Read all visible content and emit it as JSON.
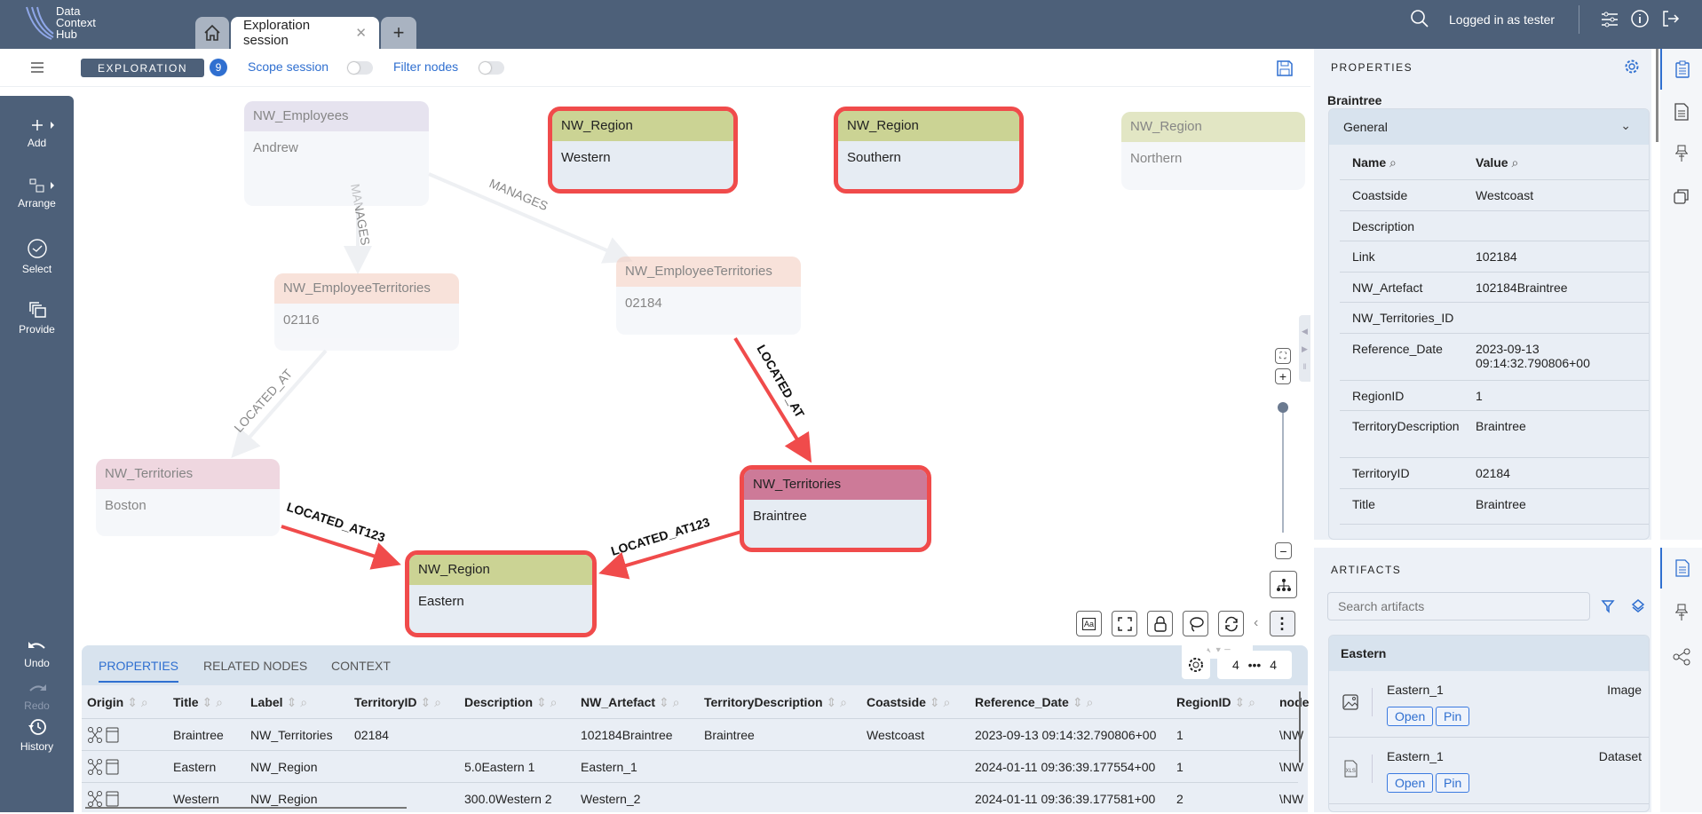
{
  "app": {
    "logo_lines": [
      "Data",
      "Context",
      "Hub"
    ],
    "tabs": [
      {
        "label": "Exploration session"
      }
    ],
    "user_text": "Logged in as tester"
  },
  "toolbar": {
    "mode": "EXPLORATION",
    "count": "9",
    "scope_session": "Scope session",
    "filter_nodes": "Filter nodes",
    "scope_on": false,
    "filter_on": false
  },
  "sidebar": {
    "items": [
      {
        "label": "Add",
        "icon": "plus-icon"
      },
      {
        "label": "Arrange",
        "icon": "arrange-icon"
      },
      {
        "label": "Select",
        "icon": "check-circle-icon"
      },
      {
        "label": "Provide",
        "icon": "copy-icon"
      }
    ],
    "bottom": [
      {
        "label": "Undo",
        "icon": "undo-icon"
      },
      {
        "label": "Redo",
        "icon": "redo-icon",
        "disabled": true
      },
      {
        "label": "History",
        "icon": "history-icon"
      }
    ]
  },
  "graph": {
    "colors": {
      "NW_Employees": "#d3cde3",
      "NW_Region": "#cbd394",
      "NW_EmployeeTerritories": "#f3cbbd",
      "NW_Territories": "#e3b7c7",
      "NW_Territories_selected": "#cd7a98",
      "selection": "#f04b4b"
    },
    "nodes": [
      {
        "label": "NW_Employees",
        "title": "Andrew"
      },
      {
        "label": "NW_Region",
        "title": "Western"
      },
      {
        "label": "NW_Region",
        "title": "Southern"
      },
      {
        "label": "NW_Region",
        "title": "Northern"
      },
      {
        "label": "NW_EmployeeTerritories",
        "title": "02116"
      },
      {
        "label": "NW_EmployeeTerritories",
        "title": "02184"
      },
      {
        "label": "NW_Territories",
        "title": "Boston"
      },
      {
        "label": "NW_Territories",
        "title": "Braintree"
      },
      {
        "label": "NW_Region",
        "title": "Eastern"
      }
    ],
    "edges": [
      {
        "from": "Andrew",
        "to": "02116",
        "label": "MANAGES"
      },
      {
        "from": "Andrew",
        "to": "02184",
        "label": "MANAGES"
      },
      {
        "from": "02116",
        "to": "Boston",
        "label": "LOCATED_AT"
      },
      {
        "from": "02184",
        "to": "Braintree",
        "label": "LOCATED_AT"
      },
      {
        "from": "Boston",
        "to": "Eastern",
        "label": "LOCATED_AT123"
      },
      {
        "from": "Braintree",
        "to": "Eastern",
        "label": "LOCATED_AT123"
      }
    ]
  },
  "bottom_panel": {
    "tabs": [
      "PROPERTIES",
      "RELATED NODES",
      "CONTEXT"
    ],
    "pager": {
      "left": "4",
      "sep": "•••",
      "right": "4"
    },
    "columns": [
      "Origin",
      "Title",
      "Label",
      "TerritoryID",
      "Description",
      "NW_Artefact",
      "TerritoryDescription",
      "Coastside",
      "Reference_Date",
      "RegionID",
      "node"
    ],
    "rows": [
      [
        "",
        "Braintree",
        "NW_Territories",
        "02184",
        "",
        "102184Braintree",
        "Braintree",
        "Westcoast",
        "2023-09-13 09:14:32.790806+00",
        "1",
        "\\NW"
      ],
      [
        "",
        "Eastern",
        "NW_Region",
        "",
        "5.0Eastern 1",
        "Eastern_1",
        "",
        "",
        "2024-01-11 09:36:39.177554+00",
        "1",
        "\\NW"
      ],
      [
        "",
        "Western",
        "NW_Region",
        "",
        "300.0Western 2",
        "Western_2",
        "",
        "",
        "2024-01-11 09:36:39.177581+00",
        "2",
        "\\NW"
      ]
    ]
  },
  "properties": {
    "heading": "PROPERTIES",
    "entity": "Braintree",
    "section": "General",
    "name_col": "Name",
    "value_col": "Value",
    "rows": [
      [
        "Coastside",
        "Westcoast"
      ],
      [
        "Description",
        ""
      ],
      [
        "Link",
        "102184"
      ],
      [
        "NW_Artefact",
        "102184Braintree"
      ],
      [
        "NW_Territories_ID",
        ""
      ],
      [
        "Reference_Date",
        "2023-09-13 09:14:32.790806+00"
      ],
      [
        "RegionID",
        "1"
      ],
      [
        "TerritoryDescription",
        "Braintree"
      ],
      [
        "TerritoryID",
        "02184"
      ],
      [
        "Title",
        "Braintree"
      ]
    ]
  },
  "artifacts": {
    "heading": "ARTIFACTS",
    "search_placeholder": "Search artifacts",
    "group": "Eastern",
    "items": [
      {
        "name": "Eastern_1",
        "type": "Image",
        "icon": "image-icon",
        "open": "Open",
        "pin": "Pin"
      },
      {
        "name": "Eastern_1",
        "type": "Dataset",
        "icon": "xls-file-icon",
        "open": "Open",
        "pin": "Pin"
      }
    ]
  }
}
